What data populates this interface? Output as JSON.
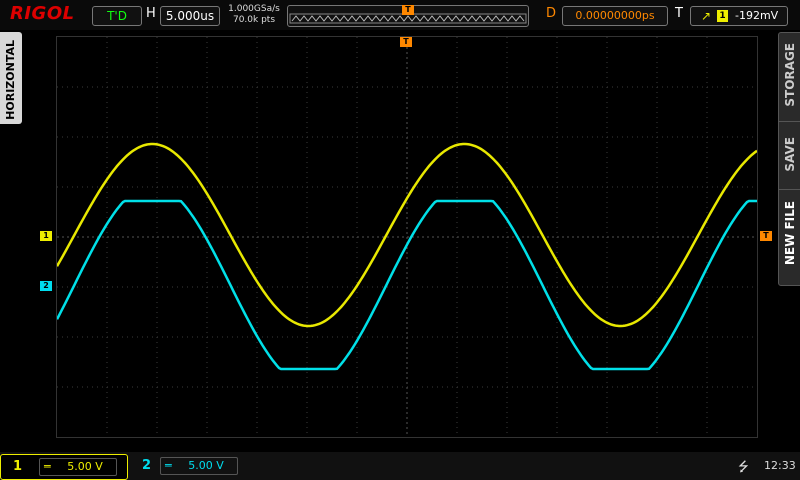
{
  "brand": "RIGOL",
  "top": {
    "run_status": "T'D",
    "horizontal_label": "H",
    "timebase": "5.000us",
    "sample_rate": "1.000GSa/s",
    "memory_depth": "70.0k pts",
    "trigger_position_marker": "T",
    "delay_label": "D",
    "delay_value": "0.00000000ps",
    "trigger_label": "T",
    "trigger_channel": "1",
    "trigger_level": "-192mV"
  },
  "side_menus": {
    "left": "HORIZONTAL",
    "right_top": "STORAGE",
    "right_mid": "SAVE",
    "right_bottom": "NEW FILE"
  },
  "channels": [
    {
      "number": "1",
      "scale": "5.00 V",
      "color": "#e8e800"
    },
    {
      "number": "2",
      "scale": "5.00 V",
      "color": "#00e0e8"
    }
  ],
  "clock": "12:33",
  "colors": {
    "ch1": "#e8e800",
    "ch2": "#00e0e8",
    "trigger": "#ff8800",
    "grid": "#3a3a3a"
  }
}
